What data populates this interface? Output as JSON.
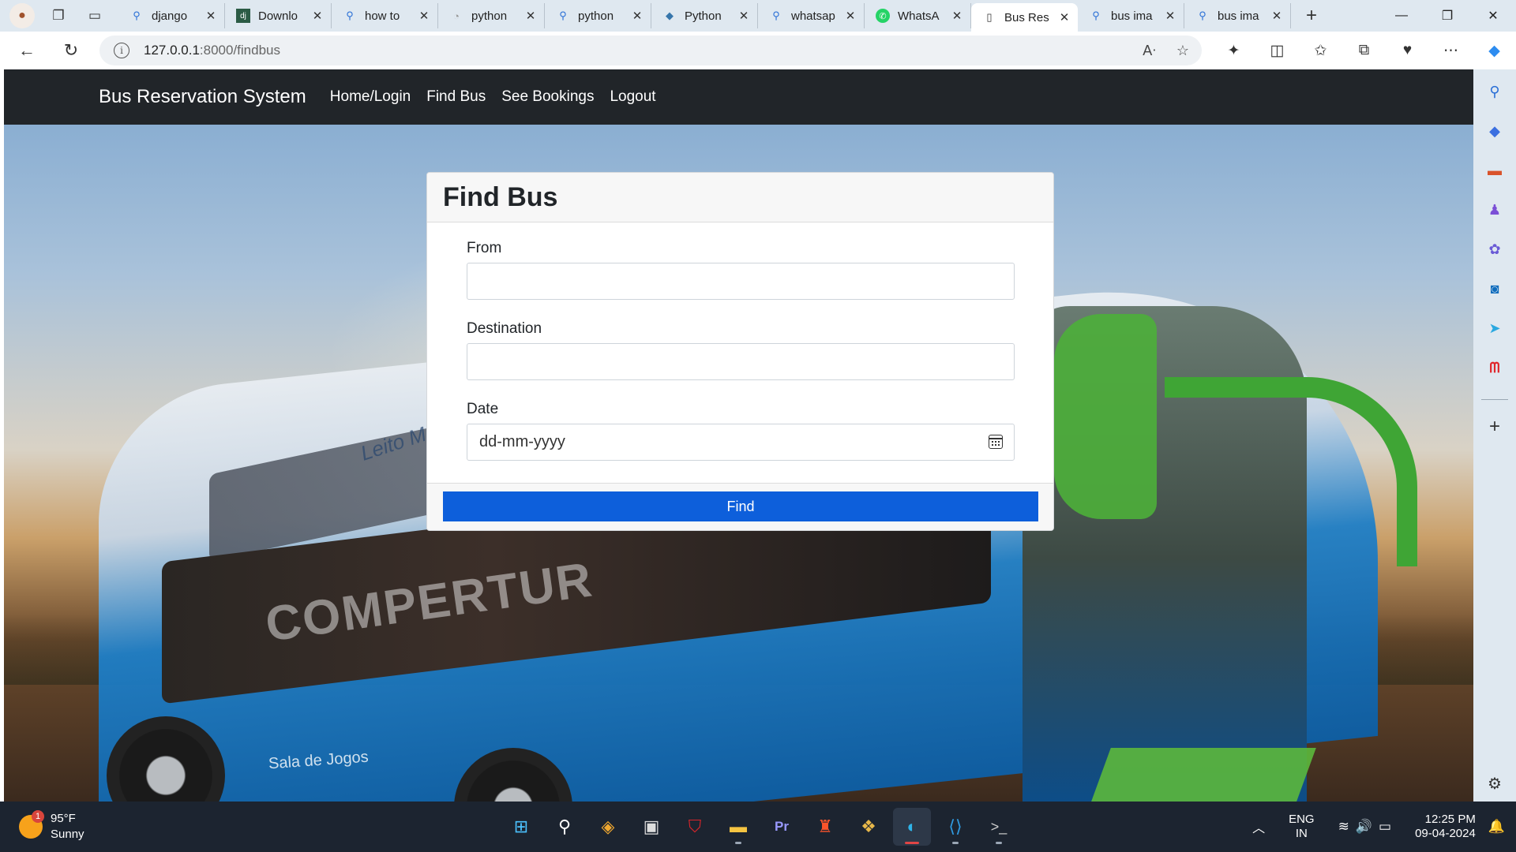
{
  "browser": {
    "tabs": [
      {
        "title": "django",
        "icon": "search-icon"
      },
      {
        "title": "Downlo",
        "icon": "django-icon"
      },
      {
        "title": "how to",
        "icon": "search-icon"
      },
      {
        "title": "python",
        "icon": "blank-page-icon"
      },
      {
        "title": "python",
        "icon": "search-icon"
      },
      {
        "title": "Python",
        "icon": "python-icon"
      },
      {
        "title": "whatsap",
        "icon": "search-icon"
      },
      {
        "title": "WhatsA",
        "icon": "whatsapp-icon"
      },
      {
        "title": "Bus Res",
        "icon": "page-icon",
        "active": true
      },
      {
        "title": "bus ima",
        "icon": "search-icon"
      },
      {
        "title": "bus ima",
        "icon": "search-icon"
      }
    ],
    "url_host": "127.0.0.1",
    "url_path": ":8000/findbus"
  },
  "site": {
    "brand": "Bus Reservation System",
    "nav": [
      "Home/Login",
      "Find Bus",
      "See Bookings",
      "Logout"
    ]
  },
  "form": {
    "title": "Find Bus",
    "from_label": "From",
    "from_value": "",
    "destination_label": "Destination",
    "destination_value": "",
    "date_label": "Date",
    "date_placeholder": "dd-mm-yyyy",
    "submit_label": "Find"
  },
  "background": {
    "bus_text": "COMPERTUR",
    "bus_text_small": "Leito Mas",
    "bus_side_text": "Sala de Jogos"
  },
  "taskbar": {
    "weather_temp": "95°F",
    "weather_desc": "Sunny",
    "weather_badge": "1",
    "lang_line1": "ENG",
    "lang_line2": "IN",
    "time": "12:25 PM",
    "date": "09-04-2024"
  },
  "colors": {
    "navbar": "#212529",
    "button": "#0d5fdb",
    "taskbar": "#1c2430",
    "chrome": "#dfe8f0"
  }
}
